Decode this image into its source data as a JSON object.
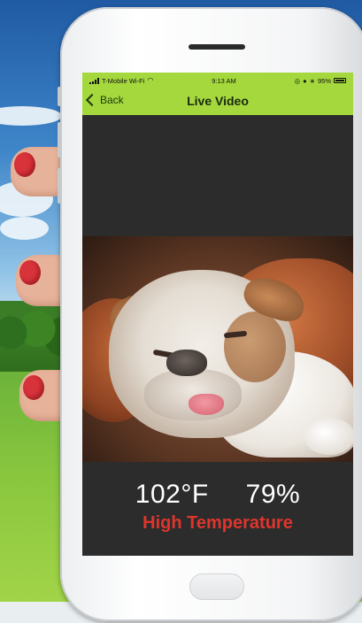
{
  "status_bar": {
    "carrier": "T-Mobile Wi-Fi",
    "time": "9:13 AM",
    "battery": "95%"
  },
  "nav": {
    "back_label": "Back",
    "title": "Live Video"
  },
  "readout": {
    "temperature": "102°F",
    "humidity": "79%",
    "alert": "High Temperature"
  },
  "colors": {
    "nav_bar": "#a4d83d",
    "screen_bg": "#2c2c2c",
    "alert": "#e0342c"
  }
}
